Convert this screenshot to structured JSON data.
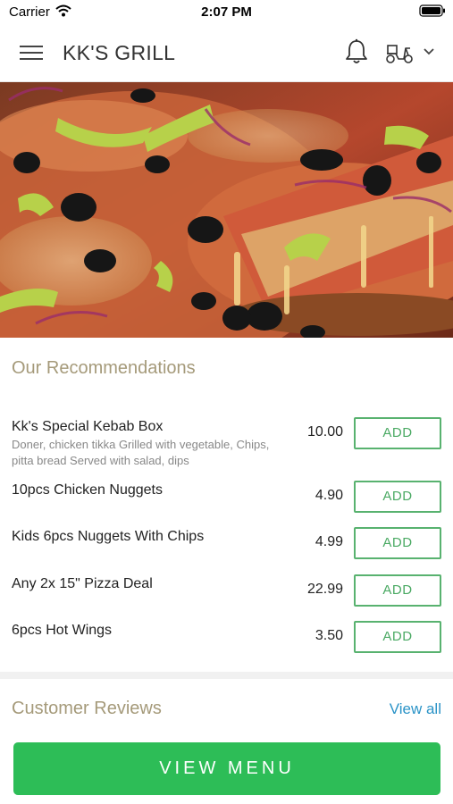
{
  "status_bar": {
    "carrier": "Carrier",
    "time": "2:07 PM"
  },
  "header": {
    "title": "KK'S GRILL",
    "icons": [
      "menu-icon",
      "bell-icon",
      "delivery-scooter-icon",
      "chevron-down-icon"
    ]
  },
  "hero": {
    "image": "pizza-photo"
  },
  "recommendations": {
    "title": "Our Recommendations",
    "add_label": "ADD",
    "items": [
      {
        "name": "Kk's Special Kebab Box",
        "description_line1": "Doner, chicken tikka Grilled with vegetable, Chips,",
        "description_line2": "pitta bread Served with salad, dips",
        "price": "10.00"
      },
      {
        "name": "10pcs Chicken Nuggets",
        "price": "4.90"
      },
      {
        "name": "Kids 6pcs Nuggets With Chips",
        "price": "4.99"
      },
      {
        "name": "Any 2x 15\" Pizza Deal",
        "price": "22.99"
      },
      {
        "name": "6pcs Hot Wings",
        "price": "3.50"
      }
    ]
  },
  "reviews": {
    "title": "Customer Reviews",
    "view_all": "View all"
  },
  "footer": {
    "view_menu": "VIEW MENU"
  },
  "colors": {
    "accent_green": "#2dbd57",
    "add_green": "#58b26f",
    "section_title": "#a59a7a",
    "link_blue": "#2a93c7"
  }
}
